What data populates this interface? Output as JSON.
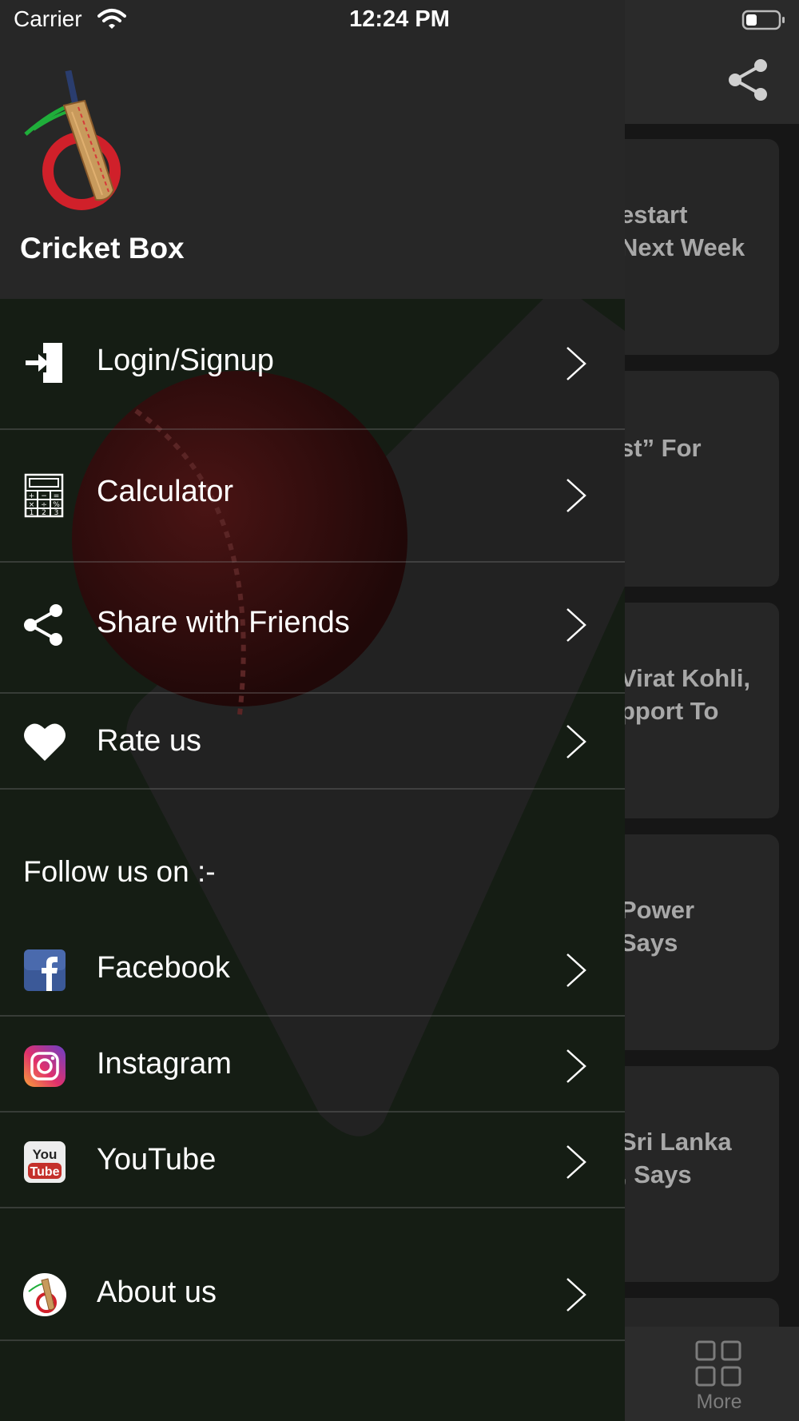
{
  "status_bar": {
    "carrier": "Carrier",
    "time": "12:24 PM"
  },
  "app": {
    "name": "Cricket Box"
  },
  "menu": {
    "login": "Login/Signup",
    "calculator": "Calculator",
    "share": "Share with Friends",
    "rate": "Rate us",
    "follow_label": "Follow us on :-",
    "facebook": "Facebook",
    "instagram": "Instagram",
    "youtube": "YouTube",
    "about": "About us"
  },
  "background": {
    "cards": [
      "estart\nNext Week",
      "st” For",
      "Virat Kohli,\npport To",
      " Power\n Says",
      "Sri Lanka\n, Says"
    ],
    "bottom_tab": "More"
  },
  "colors": {
    "drawer_header": "#272727",
    "facebook_blue": "#3b5998",
    "youtube_red": "#c4302b",
    "logo_red": "#d0202a",
    "logo_green": "#1fae3a"
  }
}
